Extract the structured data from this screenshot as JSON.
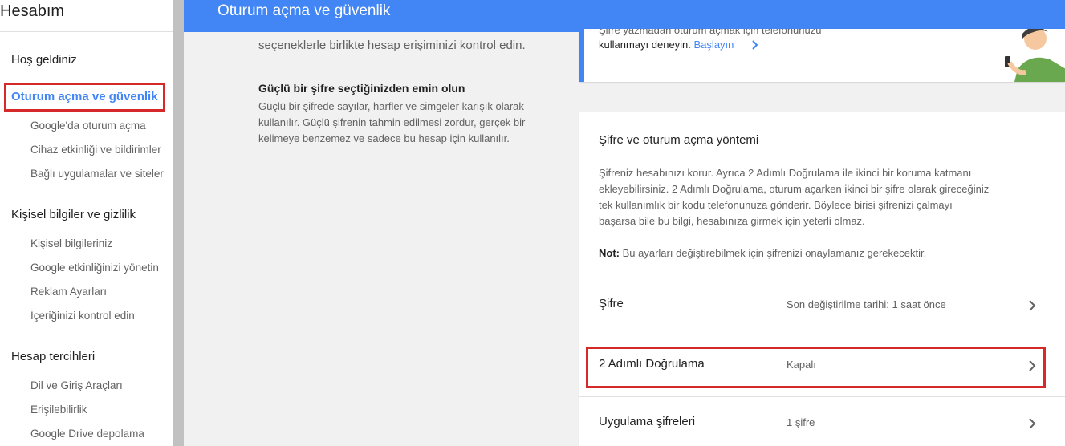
{
  "sidebar": {
    "app_title": "Hesabım",
    "sections": [
      {
        "title": "Hoş geldiniz",
        "items": []
      },
      {
        "title": "Oturum açma ve güvenlik",
        "active": true,
        "items": [
          "Google'da oturum açma",
          "Cihaz etkinliği ve bildirimler",
          "Bağlı uygulamalar ve siteler"
        ]
      },
      {
        "title": "Kişisel bilgiler ve gizlilik",
        "items": [
          "Kişisel bilgileriniz",
          "Google etkinliğinizi yönetin",
          "Reklam Ayarları",
          "İçeriğinizi kontrol edin"
        ]
      },
      {
        "title": "Hesap tercihleri",
        "items": [
          "Dil ve Giriş Araçları",
          "Erişilebilirlik",
          "Google Drive depolama"
        ]
      }
    ]
  },
  "header": {
    "title": "Oturum açma ve güvenlik"
  },
  "intro": {
    "lead": "seçeneklerle birlikte hesap erişiminizi kontrol edin.",
    "heading": "Güçlü bir şifre seçtiğinizden emin olun",
    "paragraph": "Güçlü bir şifrede sayılar, harfler ve simgeler karışık olarak kullanılır. Güçlü şifrenin tahmin edilmesi zordur, gerçek bir kelimeye benzemez ve sadece bu hesap için kullanılır."
  },
  "promo": {
    "top_partial": "Şifre yazmadan oturum açmak için telefonunuzu",
    "text": "kullanmayı deneyin.",
    "link": "Başlayın"
  },
  "card": {
    "title": "Şifre ve oturum açma yöntemi",
    "description": "Şifreniz hesabınızı korur. Ayrıca 2 Adımlı Doğrulama ile ikinci bir koruma katmanı ekleyebilirsiniz. 2 Adımlı Doğrulama, oturum açarken ikinci bir şifre olarak gireceğiniz tek kullanımlık bir kodu telefonunuza gönderir. Böylece birisi şifrenizi çalmayı başarsa bile bu bilgi, hesabınıza girmek için yeterli olmaz.",
    "note_label": "Not:",
    "note_text": " Bu ayarları değiştirebilmek için şifrenizi onaylamanız gerekecektir.",
    "rows": [
      {
        "label": "Şifre",
        "value": "Son değiştirilme tarihi: 1 saat önce"
      },
      {
        "label": "2 Adımlı Doğrulama",
        "value": "Kapalı"
      },
      {
        "label": "Uygulama şifreleri",
        "value": "1 şifre"
      }
    ]
  },
  "colors": {
    "accent": "#4285f4",
    "highlight": "#d62a2a"
  }
}
